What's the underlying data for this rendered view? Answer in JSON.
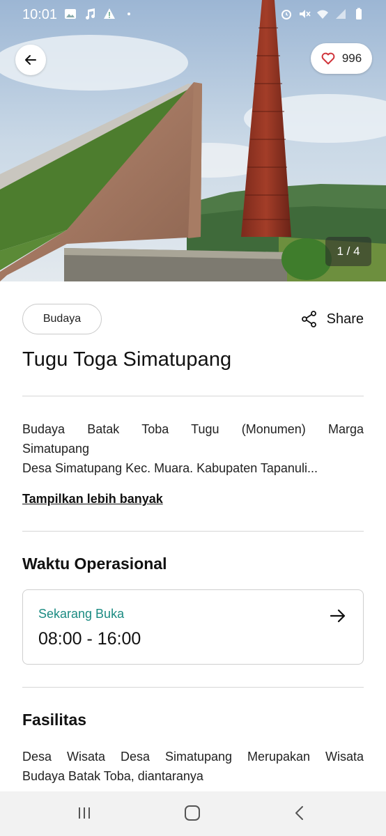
{
  "status_bar": {
    "time": "10:01",
    "left_icons": [
      "gallery-icon",
      "music-icon",
      "warning-icon",
      "dot-icon"
    ],
    "right_icons": [
      "alarm-icon",
      "mute-icon",
      "wifi-icon",
      "signal-icon",
      "battery-icon"
    ]
  },
  "hero": {
    "like_count": "996",
    "image_counter": "1 / 4"
  },
  "header": {
    "category": "Budaya",
    "share_label": "Share",
    "title": "Tugu Toga Simatupang"
  },
  "description": {
    "line1": "Budaya Batak Toba Tugu (Monumen) Marga",
    "line2": "Simatupang",
    "line3": "Desa Simatupang Kec. Muara. Kabupaten Tapanuli...",
    "more_label": "Tampilkan lebih banyak"
  },
  "operational": {
    "title": "Waktu Operasional",
    "status": "Sekarang Buka",
    "hours": "08:00 - 16:00"
  },
  "facilities": {
    "title": "Fasilitas",
    "line1": "Desa Wisata Desa Simatupang Merupakan Wisata",
    "line2": "Budaya Batak Toba, diantaranya"
  },
  "colors": {
    "accent_teal": "#1b8b82",
    "like_heart": "#d0343a",
    "navbar_bg": "#f2f2f2"
  }
}
